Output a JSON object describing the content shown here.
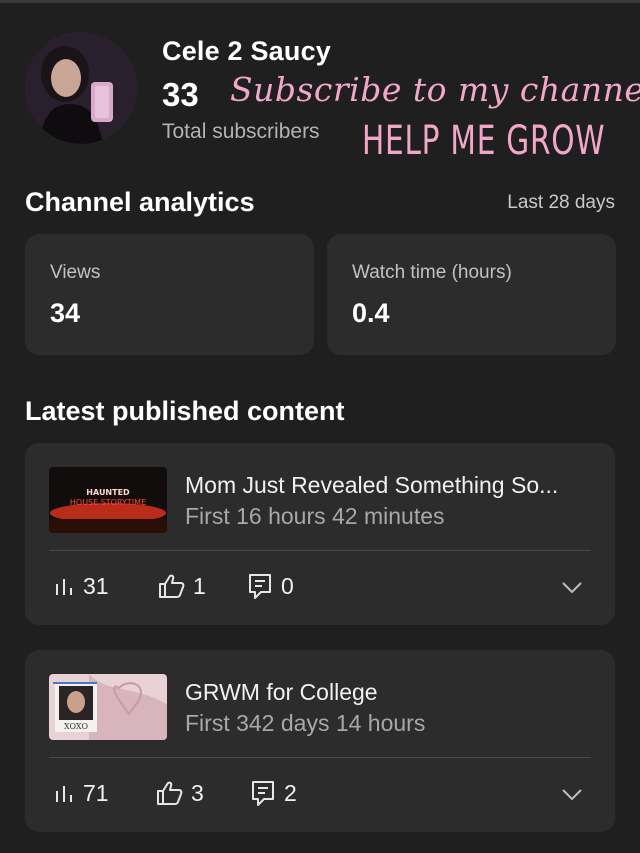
{
  "channel": {
    "name": "Cele 2 Saucy",
    "subscriber_count": "33",
    "subscriber_label": "Total subscribers"
  },
  "overlay": {
    "line1": "Subscribe to my channel",
    "line2": "HELP ME GROW",
    "color": "#f2a7c9"
  },
  "analytics": {
    "title": "Channel analytics",
    "range": "Last 28 days",
    "views_label": "Views",
    "views_value": "34",
    "watch_label": "Watch time (hours)",
    "watch_value": "0.4"
  },
  "latest": {
    "title": "Latest published content",
    "videos": [
      {
        "title": "Mom Just Revealed Something So...",
        "subtitle": "First 16 hours 42 minutes",
        "thumb_text": "HAUNTED HOUSE STORYTIME",
        "views": "31",
        "likes": "1",
        "comments": "0"
      },
      {
        "title": "GRWM for College",
        "subtitle": "First 342 days 14 hours",
        "thumb_text": "XOXO",
        "views": "71",
        "likes": "3",
        "comments": "2"
      }
    ]
  },
  "icons": [
    "bar-chart-icon",
    "thumbs-up-icon",
    "comment-icon",
    "chevron-down-icon"
  ]
}
